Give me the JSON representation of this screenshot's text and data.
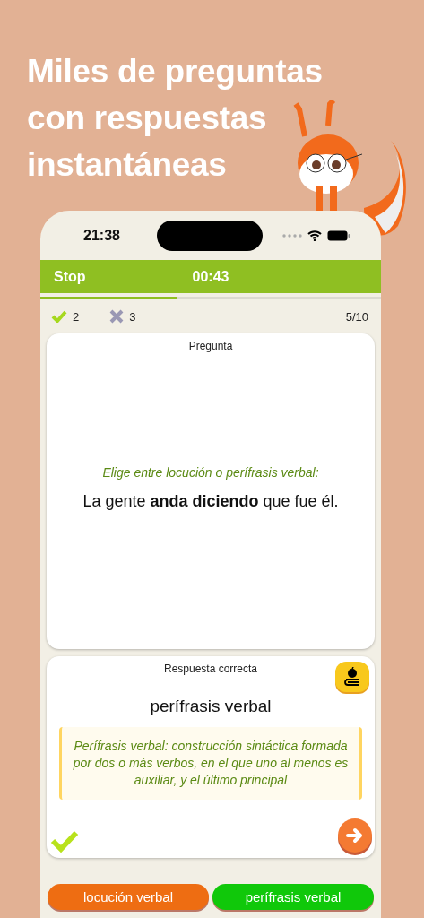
{
  "headline": "Miles de preguntas con respuestas instantáneas",
  "status_bar": {
    "time": "21:38"
  },
  "quiz_bar": {
    "stop": "Stop",
    "timer": "00:43"
  },
  "progress": {
    "level": 0.4
  },
  "score": {
    "correct": "2",
    "wrong": "3",
    "position": "5/10"
  },
  "question_card": {
    "title": "Pregunta",
    "instruction": "Elige entre locución o perífrasis verbal:",
    "sentence": "La gente **anda diciendo** que fue él."
  },
  "answer_card": {
    "title": "Respuesta correcta",
    "answer": "perífrasis verbal",
    "explanation": "Perífrasis verbal: construcción sintáctica formada por dos o más verbos, en el que uno al menos es auxiliar, y el último principal",
    "answered_correctly": true
  },
  "options": [
    {
      "label": "locución verbal",
      "color": "#ee6d12"
    },
    {
      "label": "perífrasis verbal",
      "color": "#10c80a"
    }
  ]
}
